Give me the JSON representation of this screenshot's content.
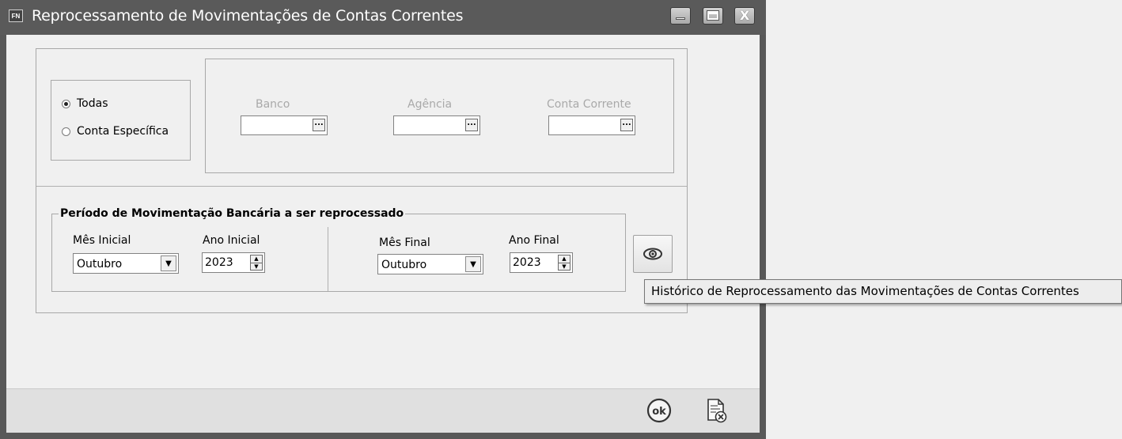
{
  "window": {
    "app_icon_text": "FN",
    "title": "Reprocessamento de Movimentações de Contas Correntes",
    "buttons": {
      "minimize": "minimize",
      "maximize": "maximize",
      "close": "X"
    }
  },
  "scope": {
    "options": [
      {
        "label": "Todas",
        "checked": true
      },
      {
        "label": "Conta Específica",
        "checked": false
      }
    ]
  },
  "account": {
    "bank_label": "Banco",
    "agency_label": "Agência",
    "account_label": "Conta Corrente",
    "bank_value": "",
    "agency_value": "",
    "account_value": "",
    "lookup_button": "..."
  },
  "period": {
    "title": "Período de Movimentação Bancária a ser reprocessado",
    "start_month_label": "Mês Inicial",
    "start_month": "Outubro",
    "start_year_label": "Ano Inicial",
    "start_year": "2023",
    "end_month_label": "Mês Final",
    "end_month": "Outubro",
    "end_year_label": "Ano Final",
    "end_year": "2023"
  },
  "history_button": {
    "icon": "eye-icon",
    "tooltip": "Histórico de Reprocessamento das Movimentações de Contas Correntes"
  },
  "footer": {
    "ok_icon": "ok-icon",
    "cancel_icon": "cancel-document-icon"
  },
  "colors": {
    "titlebar": "#5a5a5a",
    "client": "#f0f0f0",
    "footer": "#e0e0e0",
    "disabled_text": "#a9a9a9"
  }
}
